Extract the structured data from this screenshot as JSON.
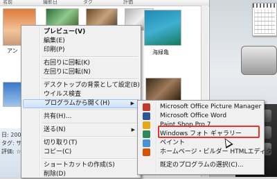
{
  "explorer": {
    "column_headers": [
      "名前",
      "撮影日",
      "タグ",
      "評価"
    ],
    "thumbnail_labels": [
      "アン",
      "海緑亀"
    ],
    "details_lines": [
      "日: 200",
      "タグ: サン",
      "評価: ☆"
    ]
  },
  "context_menu": {
    "items": [
      {
        "label": "プレビュー(V)",
        "bold": true
      },
      {
        "label": "編集(E)"
      },
      {
        "label": "印刷(P)"
      },
      {
        "sep": true
      },
      {
        "label": "右回りに回転(K)"
      },
      {
        "label": "左回りに回転(N)"
      },
      {
        "sep": true
      },
      {
        "label": "デスクトップの背景として設定(B)"
      },
      {
        "label": "ウイルス検査"
      },
      {
        "label": "プログラムから開く(H)",
        "submenu": true,
        "hover": true
      },
      {
        "sep": true
      },
      {
        "label": "共有(H)..."
      },
      {
        "sep": true
      },
      {
        "label": "送る(N)",
        "submenu": true
      },
      {
        "sep": true
      },
      {
        "label": "切り取り(T)"
      },
      {
        "label": "コピー(C)"
      },
      {
        "sep": true
      },
      {
        "label": "ショートカットの作成(S)"
      },
      {
        "label": "削除(D)"
      }
    ]
  },
  "submenu": {
    "items": [
      {
        "label": "Microsoft Office Picture Manager",
        "icon": "picture-manager-icon",
        "color": "#c0392b"
      },
      {
        "label": "Microsoft Office Word",
        "icon": "word-icon",
        "color": "#2b5797"
      },
      {
        "label": "Paint Shop Pro 7",
        "icon": "paint-shop-pro-icon",
        "color": "#e6a817"
      },
      {
        "label": "Windows フォト ギャラリー",
        "icon": "photo-gallery-icon",
        "color": "#2e8b57",
        "highlighted": true
      },
      {
        "label": "ペイント",
        "icon": "paint-icon",
        "color": "#4a90d9"
      },
      {
        "label": "ホームページ・ビルダー HTMLエディタ",
        "icon": "homepage-builder-icon",
        "color": "#d35400"
      },
      {
        "sep": true
      },
      {
        "label": "既定のプログラムの選択(C)...",
        "icon": "none"
      }
    ]
  },
  "colors": {
    "highlight_box": "#e8322b",
    "menu_bg": "#f0f0f0",
    "hover_bg": "#cde1f7"
  }
}
